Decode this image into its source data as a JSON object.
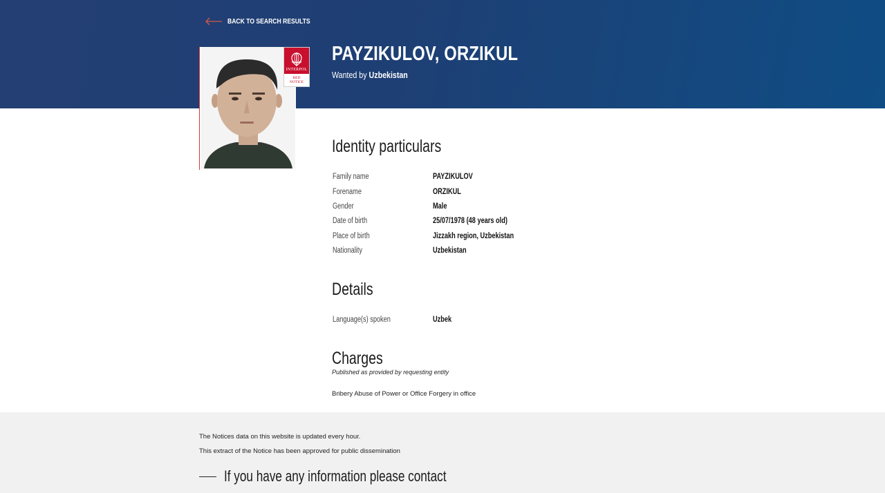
{
  "header": {
    "back_label": "BACK TO SEARCH RESULTS",
    "name": "PAYZIKULOV, ORZIKUL",
    "wanted_prefix": "Wanted by",
    "wanted_country": "Uzbekistan",
    "badge": {
      "org": "INTERPOL",
      "line1": "RED",
      "line2": "NOTICE"
    }
  },
  "identity": {
    "title": "Identity particulars",
    "rows": [
      {
        "label": "Family name",
        "value": "PAYZIKULOV"
      },
      {
        "label": "Forename",
        "value": "ORZIKUL"
      },
      {
        "label": "Gender",
        "value": "Male"
      },
      {
        "label": "Date of birth",
        "value": "25/07/1978 (48 years old)"
      },
      {
        "label": "Place of birth",
        "value": "Jizzakh region, Uzbekistan"
      },
      {
        "label": "Nationality",
        "value": "Uzbekistan"
      }
    ]
  },
  "details": {
    "title": "Details",
    "rows": [
      {
        "label": "Language(s) spoken",
        "value": "Uzbek"
      }
    ]
  },
  "charges": {
    "title": "Charges",
    "note": "Published as provided by requesting entity",
    "text": "Bribery Abuse of Power or Office Forgery in office"
  },
  "footer": {
    "line1": "The Notices data on this website is updated every hour.",
    "line2": "This extract of the Notice has been approved for public dissemination",
    "contact_heading": "If you have any information please contact"
  },
  "colors": {
    "header_bg": "#1f3f74",
    "accent_red": "#c8102e",
    "footer_bg": "#f1f1f1"
  }
}
